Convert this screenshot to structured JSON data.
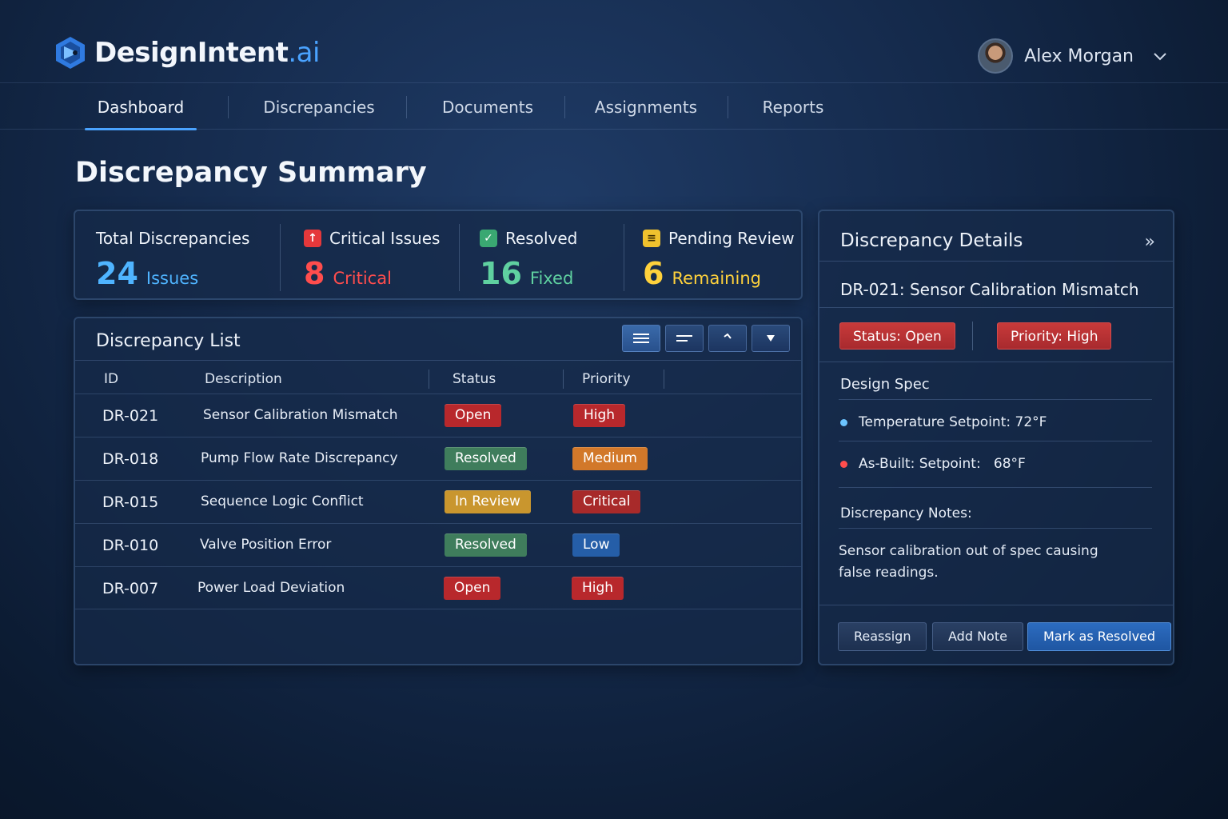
{
  "app": {
    "brand": "DesignIntent",
    "brand_suffix": ".ai"
  },
  "user": {
    "name": "Alex Morgan"
  },
  "nav": {
    "items": [
      {
        "label": "Dashboard",
        "active": true
      },
      {
        "label": "Discrepancies",
        "active": false
      },
      {
        "label": "Documents",
        "active": false
      },
      {
        "label": "Assignments",
        "active": false
      },
      {
        "label": "Reports",
        "active": false
      }
    ]
  },
  "page": {
    "title": "Discrepancy Summary"
  },
  "stats": [
    {
      "label": "Total Discrepancies",
      "value": "24",
      "unit": "Issues",
      "color": "#4fb4ff",
      "icon": ""
    },
    {
      "label": "Critical Issues",
      "value": "8",
      "unit": "Critical",
      "color": "#ff4d4d",
      "icon": "alert-icon"
    },
    {
      "label": "Resolved",
      "value": "16",
      "unit": "Fixed",
      "color": "#5fd0a0",
      "icon": "check-icon"
    },
    {
      "label": "Pending Review",
      "value": "6",
      "unit": "Remaining",
      "color": "#ffd23c",
      "icon": "pending-icon"
    }
  ],
  "list": {
    "title": "Discrepancy List",
    "columns": [
      "ID",
      "Description",
      "Status",
      "Priority"
    ],
    "rows": [
      {
        "id": "DR-021",
        "description": "Sensor Calibration Mismatch",
        "status": "Open",
        "priority": "High"
      },
      {
        "id": "DR-018",
        "description": "Pump Flow Rate Discrepancy",
        "status": "Resolved",
        "priority": "Medium"
      },
      {
        "id": "DR-015",
        "description": "Sequence Logic Conflict",
        "status": "In Review",
        "priority": "Critical"
      },
      {
        "id": "DR-010",
        "description": "Valve Position Error",
        "status": "Resolved",
        "priority": "Low"
      },
      {
        "id": "DR-007",
        "description": "Power Load Deviation",
        "status": "Open",
        "priority": "High"
      }
    ]
  },
  "colors": {
    "status_open": "#b8282c",
    "status_resolved": "#3f7d5c",
    "status_review": "#c9962e",
    "priority_high": "#b8282c",
    "priority_medium": "#d2782a",
    "priority_critical": "#a82a2a",
    "priority_low": "#255ea8"
  },
  "detail": {
    "title": "Discrepancy Details",
    "item_title": "DR-021: Sensor Calibration Mismatch",
    "status_label": "Status:",
    "status_value": "Open",
    "priority_label": "Priority:",
    "priority_value": "High",
    "design_spec_label": "Design Spec",
    "spec_items": [
      {
        "label": "Temperature Setpoint:",
        "value": "72°F",
        "dot_color": "#6cc4ff"
      },
      {
        "label": "As-Built: Setpoint:",
        "value": "68°F",
        "dot_color": "#ff4d4d"
      }
    ],
    "notes_label": "Discrepancy Notes:",
    "notes_text": "Sensor calibration out of spec causing false readings.",
    "buttons": {
      "reassign": "Reassign",
      "add_note": "Add Note",
      "resolve": "Mark as Resolved"
    }
  }
}
